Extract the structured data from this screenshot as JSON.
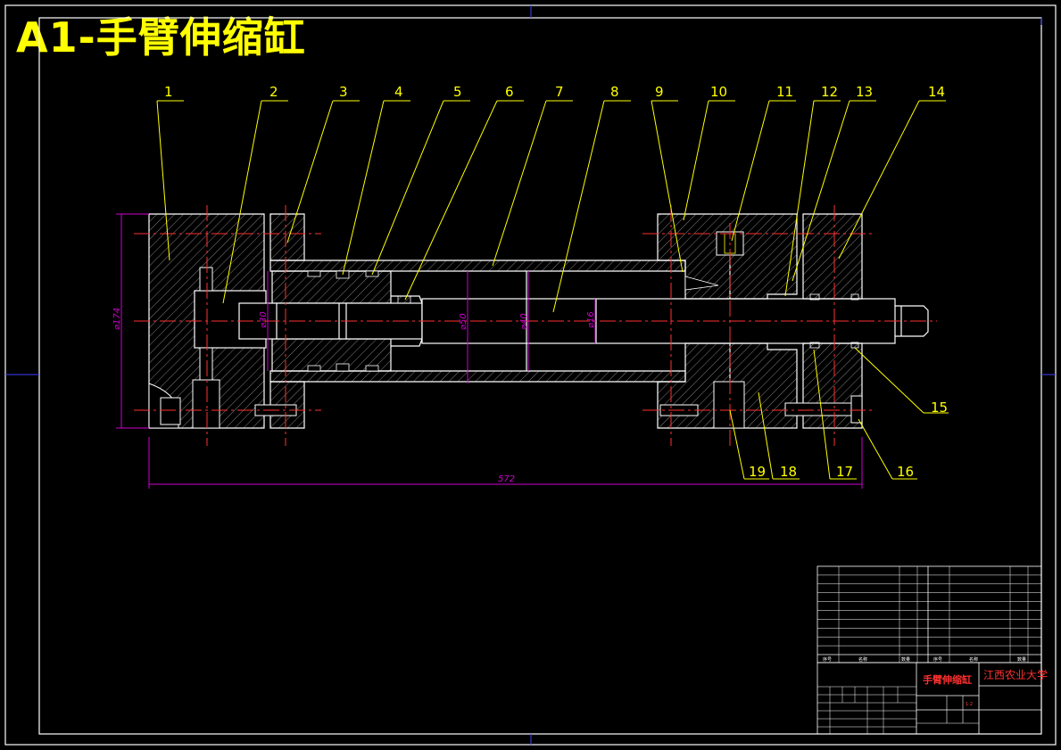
{
  "title": "A1-手臂伸缩缸",
  "part_numbers": [
    "1",
    "2",
    "3",
    "4",
    "5",
    "6",
    "7",
    "8",
    "9",
    "10",
    "11",
    "12",
    "13",
    "14",
    "15",
    "16",
    "17",
    "18",
    "19"
  ],
  "dimensions": {
    "overall_length": "572",
    "outer_diameter": "⌀174",
    "d1": "⌀30",
    "d2": "⌀50",
    "d3": "⌀40",
    "d4": "⌀16"
  },
  "title_block": {
    "drawing_name": "手臂伸缩缸",
    "university": "江西农业大学",
    "scale_value": "1:2",
    "header_seq": "序号",
    "header_name": "名称",
    "header_qty": "数量"
  },
  "colors": {
    "background": "#000000",
    "outline": "#ffffff",
    "leader": "#ffff00",
    "centerline": "#ff3030",
    "dimension": "#d000d0",
    "frame": "#ffffff"
  }
}
